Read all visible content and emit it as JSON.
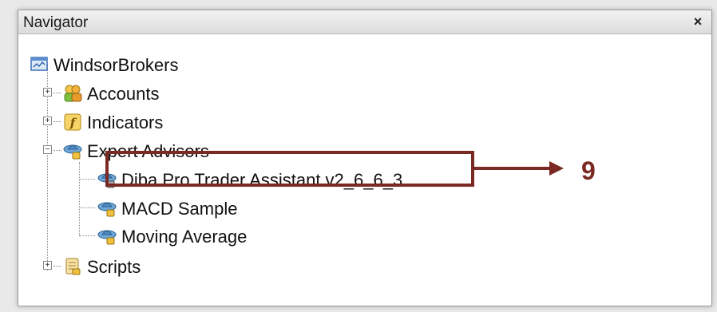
{
  "window": {
    "title": "Navigator",
    "close_glyph": "×"
  },
  "tree": {
    "root": {
      "label": "WindsorBrokers",
      "icon": "terminal-icon"
    },
    "items": [
      {
        "label": "Accounts",
        "icon": "accounts-icon",
        "expander": "+"
      },
      {
        "label": "Indicators",
        "icon": "indicator-icon",
        "expander": "+"
      },
      {
        "label": "Expert Advisors",
        "icon": "expert-advisor-icon",
        "expander": "−",
        "children": [
          {
            "label": "Diba Pro Trader Assistant v2_6_6_3",
            "icon": "expert-advisor-icon"
          },
          {
            "label": "MACD Sample",
            "icon": "expert-advisor-icon"
          },
          {
            "label": "Moving Average",
            "icon": "expert-advisor-icon"
          }
        ]
      },
      {
        "label": "Scripts",
        "icon": "script-icon",
        "expander": "+"
      }
    ]
  },
  "annotation": {
    "step_number": "9",
    "color": "#7a2a22"
  }
}
